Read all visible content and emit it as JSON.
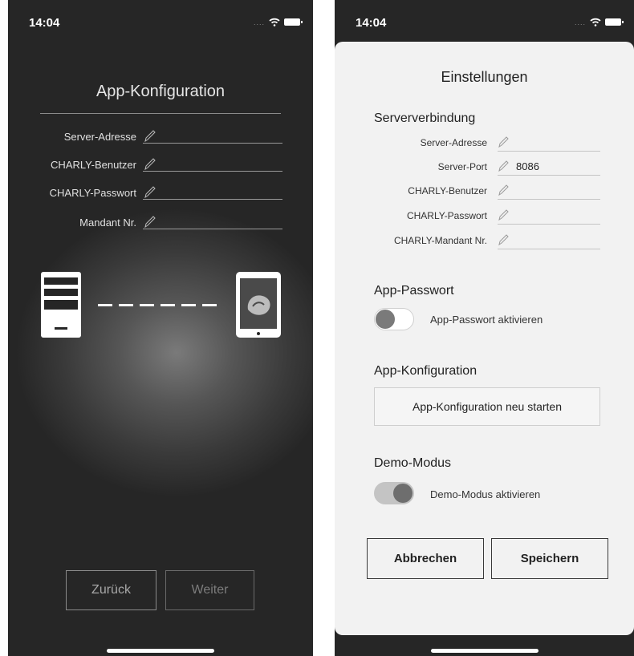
{
  "left": {
    "status": {
      "time": "14:04"
    },
    "title": "App-Konfiguration",
    "fields": [
      {
        "label": "Server-Adresse"
      },
      {
        "label": "CHARLY-Benutzer"
      },
      {
        "label": "CHARLY-Passwort"
      },
      {
        "label": "Mandant Nr."
      }
    ],
    "icons": {
      "edit": "pencil-icon",
      "server": "server-icon",
      "tablet": "tablet-icon",
      "wifi": "wifi-icon",
      "battery": "battery-icon"
    },
    "buttons": {
      "back": "Zurück",
      "next": "Weiter"
    }
  },
  "right": {
    "status": {
      "time": "14:04"
    },
    "title": "Einstellungen",
    "server_section": {
      "heading": "Serververbindung",
      "fields": [
        {
          "label": "Server-Adresse",
          "value": ""
        },
        {
          "label": "Server-Port",
          "value": "8086"
        },
        {
          "label": "CHARLY-Benutzer",
          "value": ""
        },
        {
          "label": "CHARLY-Passwort",
          "value": ""
        },
        {
          "label": "CHARLY-Mandant Nr.",
          "value": ""
        }
      ]
    },
    "app_password": {
      "heading": "App-Passwort",
      "toggle_label": "App-Passwort aktivieren",
      "enabled": false
    },
    "app_config": {
      "heading": "App-Konfiguration",
      "button": "App-Konfiguration neu starten"
    },
    "demo_mode": {
      "heading": "Demo-Modus",
      "toggle_label": "Demo-Modus aktivieren",
      "enabled": true
    },
    "buttons": {
      "cancel": "Abbrechen",
      "save": "Speichern"
    }
  },
  "colors": {
    "dark_bg": "#262626",
    "sheet_bg": "#f2f2f2",
    "text_light": "#e6e6e6",
    "accent_line": "#9a9a9a"
  }
}
